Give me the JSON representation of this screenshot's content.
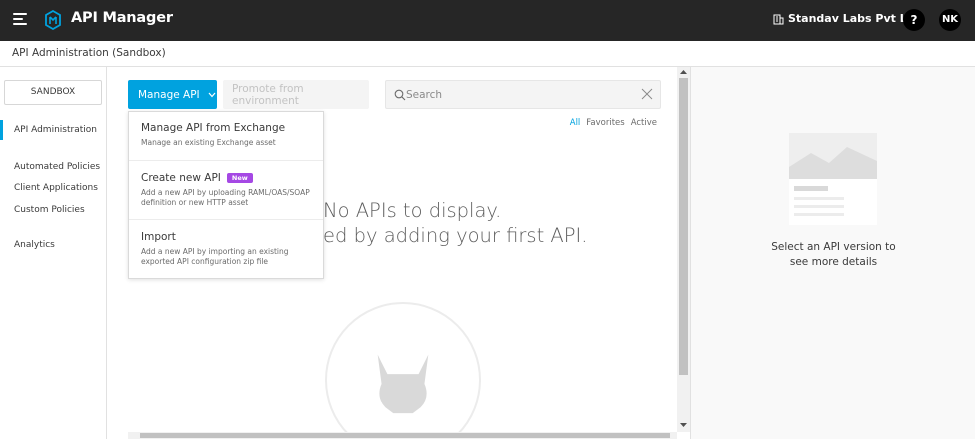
{
  "header": {
    "app_title": "API Manager",
    "org_name": "Standav Labs Pvt Ltd",
    "help_label": "?",
    "user_initials": "NK"
  },
  "breadcrumb": {
    "text": "API Administration (Sandbox)"
  },
  "sidebar": {
    "environment_button": "SANDBOX",
    "items": [
      {
        "label": "API Administration",
        "active": true
      },
      {
        "label": "Automated Policies",
        "active": false
      },
      {
        "label": "Client Applications",
        "active": false
      },
      {
        "label": "Custom Policies",
        "active": false
      },
      {
        "label": "Analytics",
        "active": false
      }
    ]
  },
  "toolbar": {
    "manage_api_label": "Manage API",
    "promote_label": "Promote from environment",
    "search_placeholder": "Search"
  },
  "filters": [
    "All",
    "Favorites",
    "Active"
  ],
  "empty_state": {
    "line1": "No APIs to display.",
    "line2": "ed by adding your first API."
  },
  "dropdown": {
    "items": [
      {
        "title": "Manage API from Exchange",
        "description": "Manage an existing Exchange asset",
        "badge": ""
      },
      {
        "title": "Create new API",
        "description": "Add a new API by uploading RAML/OAS/SOAP definition or new HTTP asset",
        "badge": "New"
      },
      {
        "title": "Import",
        "description": "Add a new API by importing an existing exported API configuration zip file",
        "badge": ""
      }
    ]
  },
  "detail_panel": {
    "text": "Select an API version to see more details"
  },
  "colors": {
    "accent": "#00a2df",
    "topbar": "#262626",
    "badge": "#a548e4"
  },
  "icons": [
    "hamburger-icon",
    "mulesoft-logo-icon",
    "building-icon",
    "search-icon",
    "close-icon",
    "chevron-down-icon"
  ]
}
